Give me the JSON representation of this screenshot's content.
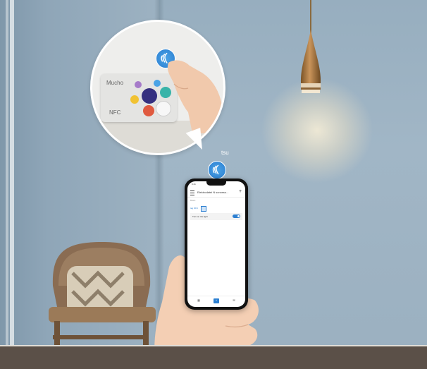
{
  "bubble": {
    "card_brand": "Mucho",
    "card_type": "NFC"
  },
  "tag_label": "tsu",
  "phone": {
    "status_time": "9:41",
    "app_title": "Elektrodatei N sonosso...",
    "plus_symbol": "+",
    "section_label": "Basis",
    "trigger_label": "tag NFC",
    "action_label": "Turn on the light",
    "tabs": [
      "Tags",
      "Scan",
      "Rules"
    ]
  },
  "colors": {
    "accent": "#2c7fd1",
    "wall": "#9db2c2"
  }
}
